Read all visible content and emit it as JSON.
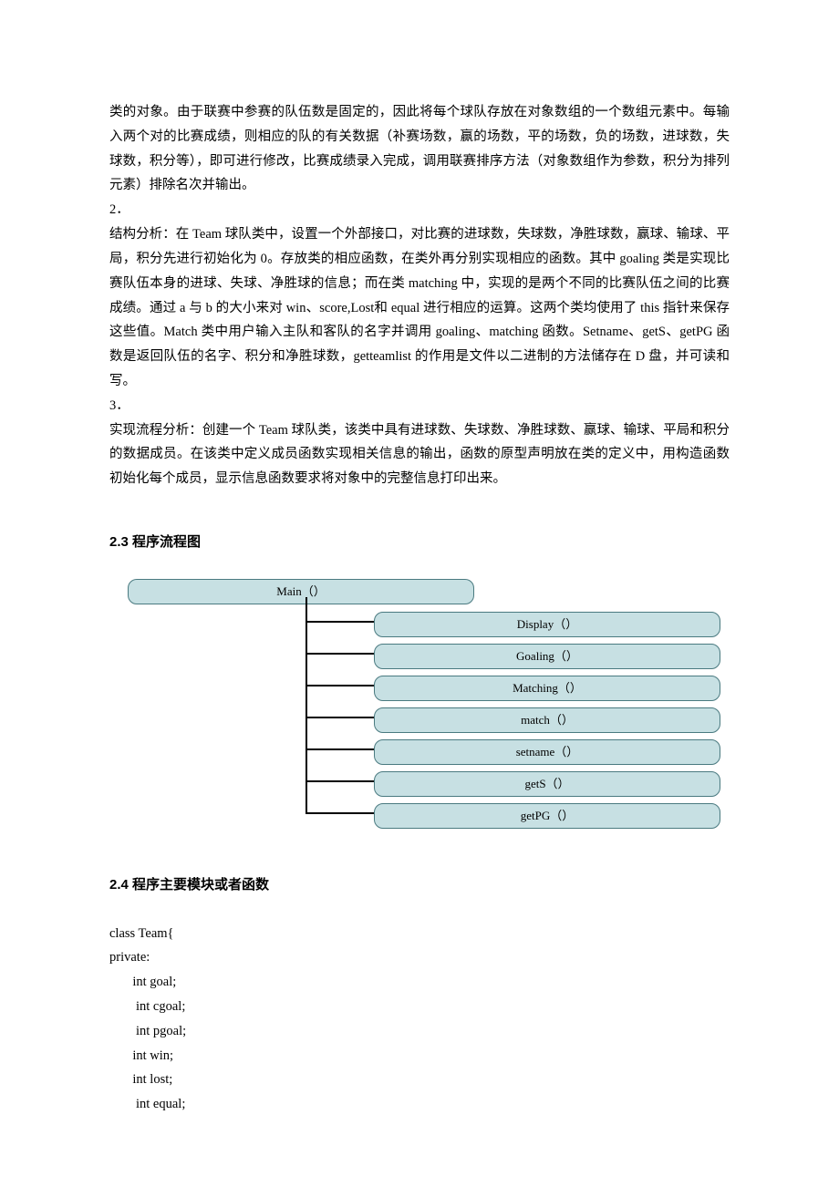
{
  "para1": "类的对象。由于联赛中参赛的队伍数是固定的，因此将每个球队存放在对象数组的一个数组元素中。每输入两个对的比赛成绩，则相应的队的有关数据（补赛场数，赢的场数，平的场数，负的场数，进球数，失球数，积分等），即可进行修改，比赛成绩录入完成，调用联赛排序方法（对象数组作为参数，积分为排列元素）排除名次并输出。",
  "sec2": "2．",
  "para2": "结构分析：在 Team 球队类中，设置一个外部接口，对比赛的进球数，失球数，净胜球数，赢球、输球、平局，积分先进行初始化为 0。存放类的相应函数，在类外再分别实现相应的函数。其中 goaling 类是实现比赛队伍本身的进球、失球、净胜球的信息；而在类 matching 中，实现的是两个不同的比赛队伍之间的比赛成绩。通过 a 与 b 的大小来对 win、score,Lost和 equal 进行相应的运算。这两个类均使用了 this 指针来保存这些值。Match 类中用户输入主队和客队的名字并调用 goaling、matching 函数。Setname、getS、getPG 函数是返回队伍的名字、积分和净胜球数，getteamlist 的作用是文件以二进制的方法储存在 D 盘，并可读和写。",
  "sec3": "3．",
  "para3": "实现流程分析：创建一个 Team 球队类，该类中具有进球数、失球数、净胜球数、赢球、输球、平局和积分的数据成员。在该类中定义成员函数实现相关信息的输出，函数的原型声明放在类的定义中，用构造函数初始化每个成员，显示信息函数要求将对象中的完整信息打印出来。",
  "heading23": "2.3 程序流程图",
  "heading24": "2.4  程序主要模块或者函数",
  "diagram": {
    "main": "Main（）",
    "children": [
      "Display（）",
      "Goaling（）",
      "Matching（）",
      "match（）",
      "setname（）",
      "getS（）",
      "getPG（）"
    ]
  },
  "code": [
    "class Team{",
    "private:",
    "       int goal;",
    "        int cgoal;",
    "        int pgoal;",
    "       int win;",
    "       int lost;",
    "        int equal;"
  ]
}
